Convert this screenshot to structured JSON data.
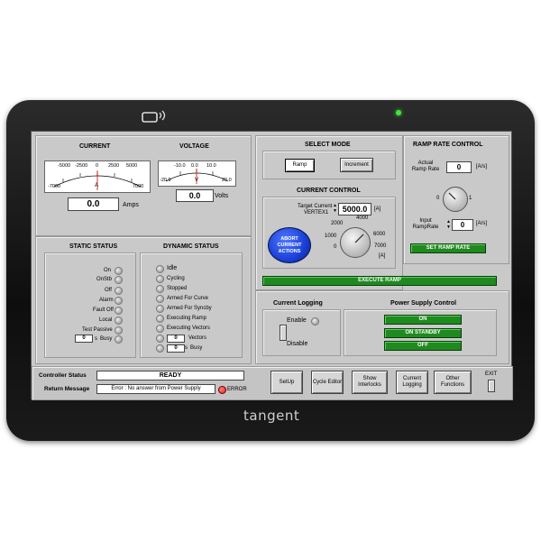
{
  "brand": "tangent",
  "current_meter": {
    "title": "CURRENT",
    "scale_top": [
      "-5000",
      "-2500",
      "0",
      "2500",
      "5000"
    ],
    "scale_bottom": [
      "-7000",
      "A",
      "7000"
    ],
    "value": "0.0",
    "unit": "Amps"
  },
  "voltage_meter": {
    "title": "VOLTAGE",
    "scale_top": [
      "-10.0",
      "0.0",
      "10.0"
    ],
    "scale_bottom": [
      "-20.0",
      "V",
      "20.0"
    ],
    "value": "0.0",
    "unit": "Volts"
  },
  "select_mode": {
    "title": "SELECT MODE",
    "ramp_label": "Ramp",
    "increment_label": "Increment"
  },
  "current_control": {
    "title": "CURRENT CONTROL",
    "target_label": "Target Current",
    "target_sub": "VERTEX1",
    "target_value": "5000.0",
    "target_unit": "[A]",
    "abort_label": "ABORT CURRENT ACTIONS",
    "knob_labels": [
      "2000",
      "4000",
      "1000",
      "6000",
      "0",
      "7000"
    ],
    "knob_unit": "[A]"
  },
  "ramp_rate": {
    "title": "RAMP RATE CONTROL",
    "actual_label": "Actual Ramp Rate",
    "actual_value": "0",
    "actual_unit": "[A/s]",
    "knob_min": "0",
    "knob_max": "1",
    "input_label": "Input RampRate",
    "input_value": "0",
    "input_unit": "[A/s]",
    "set_button": "SET RAMP RATE"
  },
  "execute_ramp": "EXECUTE RAMP",
  "static_status": {
    "title": "STATIC STATUS",
    "items": [
      "On",
      "OnStb",
      "Off",
      "Alarm",
      "Fault Off",
      "Local",
      "Test Passive",
      "Busy"
    ],
    "busy_count": "0",
    "busy_unit": "s"
  },
  "dynamic_status": {
    "title": "DYNAMIC STATUS",
    "items": [
      "Idle",
      "Cycling",
      "Stopped",
      "Armed For Curve",
      "Armed For Syncby",
      "Executing Ramp",
      "Executing Vectors",
      "Vectors",
      "Busy"
    ],
    "vectors_count": "0",
    "busy_count": "0",
    "busy_unit": "s"
  },
  "current_logging": {
    "title": "Current Logging",
    "enable": "Enable",
    "disable": "Disable"
  },
  "power_supply": {
    "title": "Power Supply Control",
    "on": "ON",
    "standby": "ON STANDBY",
    "off": "OFF"
  },
  "footer": {
    "controller_status_label": "Controller Status",
    "controller_status_value": "READY",
    "return_message_label": "Return Message",
    "return_message_value": "Error : No answer from Power Supply",
    "error_label": "ERROR",
    "buttons": [
      "SetUp",
      "Cycle Editor",
      "Show Interlocks",
      "Current Logging",
      "Other Functions"
    ],
    "exit_label": "EXIT"
  },
  "colors": {
    "screen_bg": "#c9c9c9",
    "green_button": "#1f8a1f",
    "abort_button": "#1a3fd6",
    "error_led": "#e02020",
    "camera_led": "#3ee63e"
  }
}
